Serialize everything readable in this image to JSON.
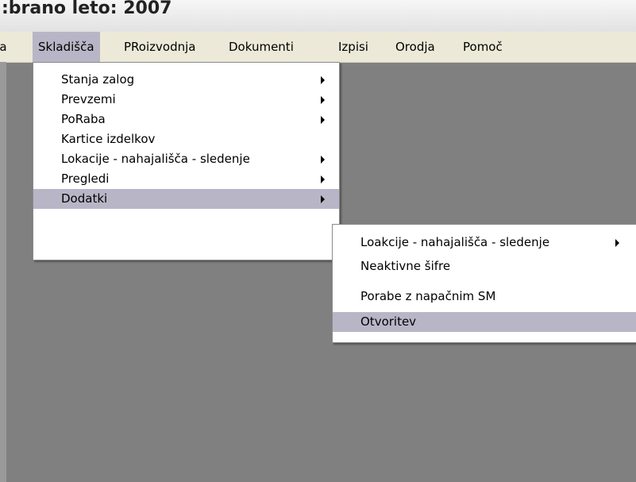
{
  "window": {
    "title": ":brano leto: 2007"
  },
  "menubar": {
    "items": [
      {
        "label": "Ja"
      },
      {
        "label": "Skladišča"
      },
      {
        "label": "PRoizvodnja"
      },
      {
        "label": "Dokumenti"
      },
      {
        "label": "Izpisi"
      },
      {
        "label": "Orodja"
      },
      {
        "label": "Pomoč"
      }
    ],
    "active": "Skladišča"
  },
  "skladisca_menu": {
    "items": [
      {
        "label": "Stanja zalog",
        "submenu": true
      },
      {
        "label": "Prevzemi",
        "submenu": true
      },
      {
        "label": "PoRaba",
        "submenu": true
      },
      {
        "label": "Kartice izdelkov",
        "submenu": false
      },
      {
        "label": "Lokacije - nahajališča - sledenje",
        "submenu": true
      },
      {
        "label": "Pregledi",
        "submenu": true
      },
      {
        "label": "Dodatki",
        "submenu": true,
        "highlighted": true
      }
    ]
  },
  "dodatki_menu": {
    "items": [
      {
        "label": "Loakcije - nahajališča - sledenje",
        "submenu": true
      },
      {
        "label": "Neaktivne šifre",
        "submenu": false
      },
      {
        "label": "Porabe z napačnim SM",
        "submenu": false
      },
      {
        "label": "Otvoritev",
        "submenu": false,
        "highlighted": true
      }
    ]
  },
  "colors": {
    "desktop_bg": "#808080",
    "menubar_bg": "#ece9d8",
    "highlight": "#b8b6c6",
    "menu_bg": "#ffffff"
  }
}
